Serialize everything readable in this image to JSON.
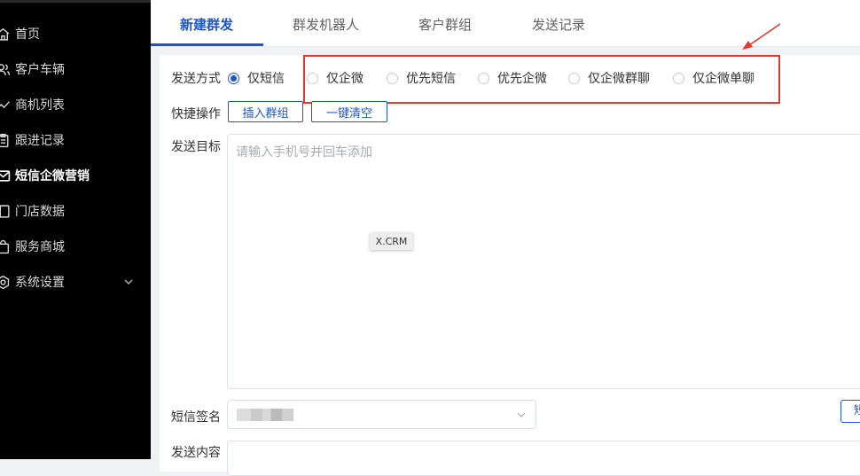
{
  "sidebar": {
    "items": [
      {
        "label": "首页",
        "icon": "home-icon"
      },
      {
        "label": "客户车辆",
        "icon": "users-icon"
      },
      {
        "label": "商机列表",
        "icon": "trend-chart-icon"
      },
      {
        "label": "跟进记录",
        "icon": "clipboard-icon"
      },
      {
        "label": "短信企微营销",
        "icon": "mail-icon",
        "active": true
      },
      {
        "label": "门店数据",
        "icon": "data-board-icon"
      },
      {
        "label": "服务商城",
        "icon": "shopping-bag-icon"
      },
      {
        "label": "系统设置",
        "icon": "settings-icon"
      }
    ]
  },
  "tabs": [
    {
      "label": "新建群发",
      "active": true
    },
    {
      "label": "群发机器人"
    },
    {
      "label": "客户群组"
    },
    {
      "label": "发送记录"
    }
  ],
  "form": {
    "send_method_label": "发送方式",
    "send_methods": [
      {
        "label": "仅短信",
        "checked": true
      },
      {
        "label": "仅企微"
      },
      {
        "label": "优先短信"
      },
      {
        "label": "优先企微"
      },
      {
        "label": "仅企微群聊"
      },
      {
        "label": "仅企微单聊"
      }
    ],
    "quick_ops_label": "快捷操作",
    "insert_group_button": "插入群组",
    "clear_all_button": "一键清空",
    "target_label": "发送目标",
    "target_placeholder": "请输入手机号并回车添加",
    "watermark": "X.CRM",
    "signature_label": "短信签名",
    "edge_button": "短",
    "content_label": "发送内容"
  },
  "colors": {
    "accent": "#1f55c8",
    "highlight_box": "#e8362d",
    "sidebar_bg": "#000000"
  }
}
